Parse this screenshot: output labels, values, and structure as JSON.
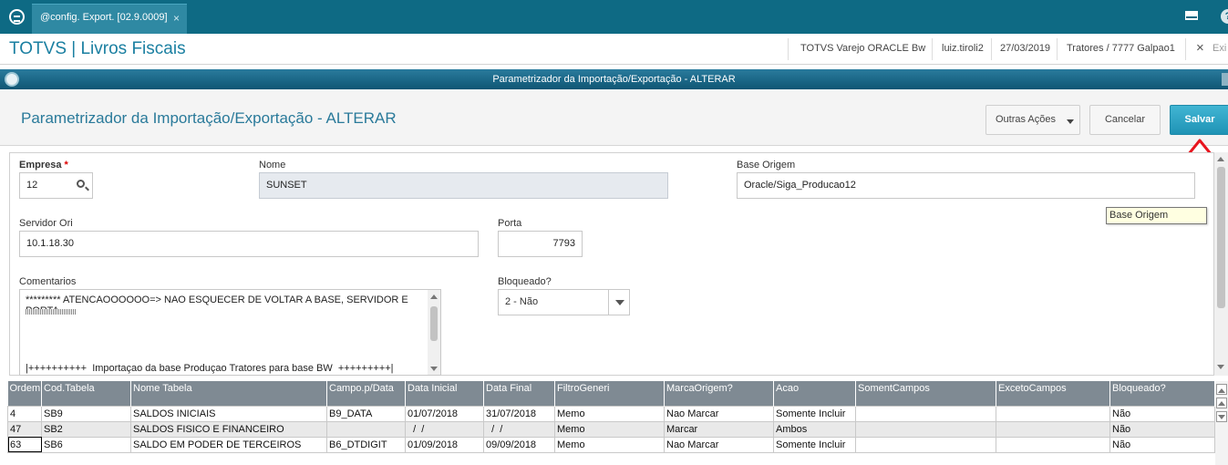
{
  "tab": {
    "label": "@config. Export. [02.9.0009]",
    "close": "×"
  },
  "app": {
    "title": "TOTVS | Livros Fiscais",
    "environment": "TOTVS Varejo ORACLE Bw",
    "user": "luiz.tiroli2",
    "date": "27/03/2019",
    "branch": "Tratores / 7777 Galpao1",
    "exit_icon": "×",
    "exit_label": "Exi"
  },
  "dialog": {
    "window_title": "Parametrizador da Importação/Exportação - ALTERAR",
    "heading": "Parametrizador da Importação/Exportação - ALTERAR",
    "buttons": {
      "other_actions": "Outras Ações",
      "cancel": "Cancelar",
      "save": "Salvar"
    }
  },
  "form": {
    "empresa": {
      "label": "Empresa",
      "required_mark": "*",
      "value": "12"
    },
    "nome": {
      "label": "Nome",
      "value": "SUNSET"
    },
    "base_origem": {
      "label": "Base Origem",
      "value": "Oracle/Siga_Producao12",
      "tooltip": "Base Origem"
    },
    "servidor_ori": {
      "label": "Servidor Ori",
      "value": "10.1.18.30"
    },
    "porta": {
      "label": "Porta",
      "value": "7793"
    },
    "comentarios": {
      "label": "Comentarios",
      "line1": "********* ATENCAOOOOOO=> NAO ESQUECER DE VOLTAR A BASE, SERVIDOR E PORTA",
      "line3": "|++++++++++  Importaçao da base Produçao Tratores para base BW  +++++++++|"
    },
    "bloqueado": {
      "label": "Bloqueado?",
      "value": "2 - Não"
    }
  },
  "grid": {
    "columns": [
      "Ordem",
      "Cod.Tabela",
      "Nome Tabela",
      "Campo.p/Data",
      "Data Inicial",
      "Data Final",
      "FiltroGeneri",
      "MarcaOrigem?",
      "Acao",
      "SomentCampos",
      "ExcetoCampos",
      "Bloqueado?"
    ],
    "rows": [
      [
        "4",
        "SB9",
        "SALDOS INICIAIS",
        "B9_DATA",
        "01/07/2018",
        "31/07/2018",
        "Memo",
        "Nao Marcar",
        "Somente Incluir",
        "",
        "",
        "Não"
      ],
      [
        "47",
        "SB2",
        "SALDOS FISICO E FINANCEIRO",
        "",
        "  /  /",
        "  /  /",
        "Memo",
        "Marcar",
        "Ambos",
        "",
        "",
        "Não"
      ],
      [
        "63",
        "SB6",
        "SALDO EM PODER DE TERCEIROS",
        "B6_DTDIGIT",
        "01/09/2018",
        "09/09/2018",
        "Memo",
        "Nao Marcar",
        "Somente Incluir",
        "",
        "",
        "Não"
      ]
    ]
  },
  "colors": {
    "topbar": "#0e6a84",
    "accent": "#1a7fa1",
    "primary_button": "#32a7c6",
    "grid_header": "#7f8a93",
    "arrow": "#e8141e"
  }
}
